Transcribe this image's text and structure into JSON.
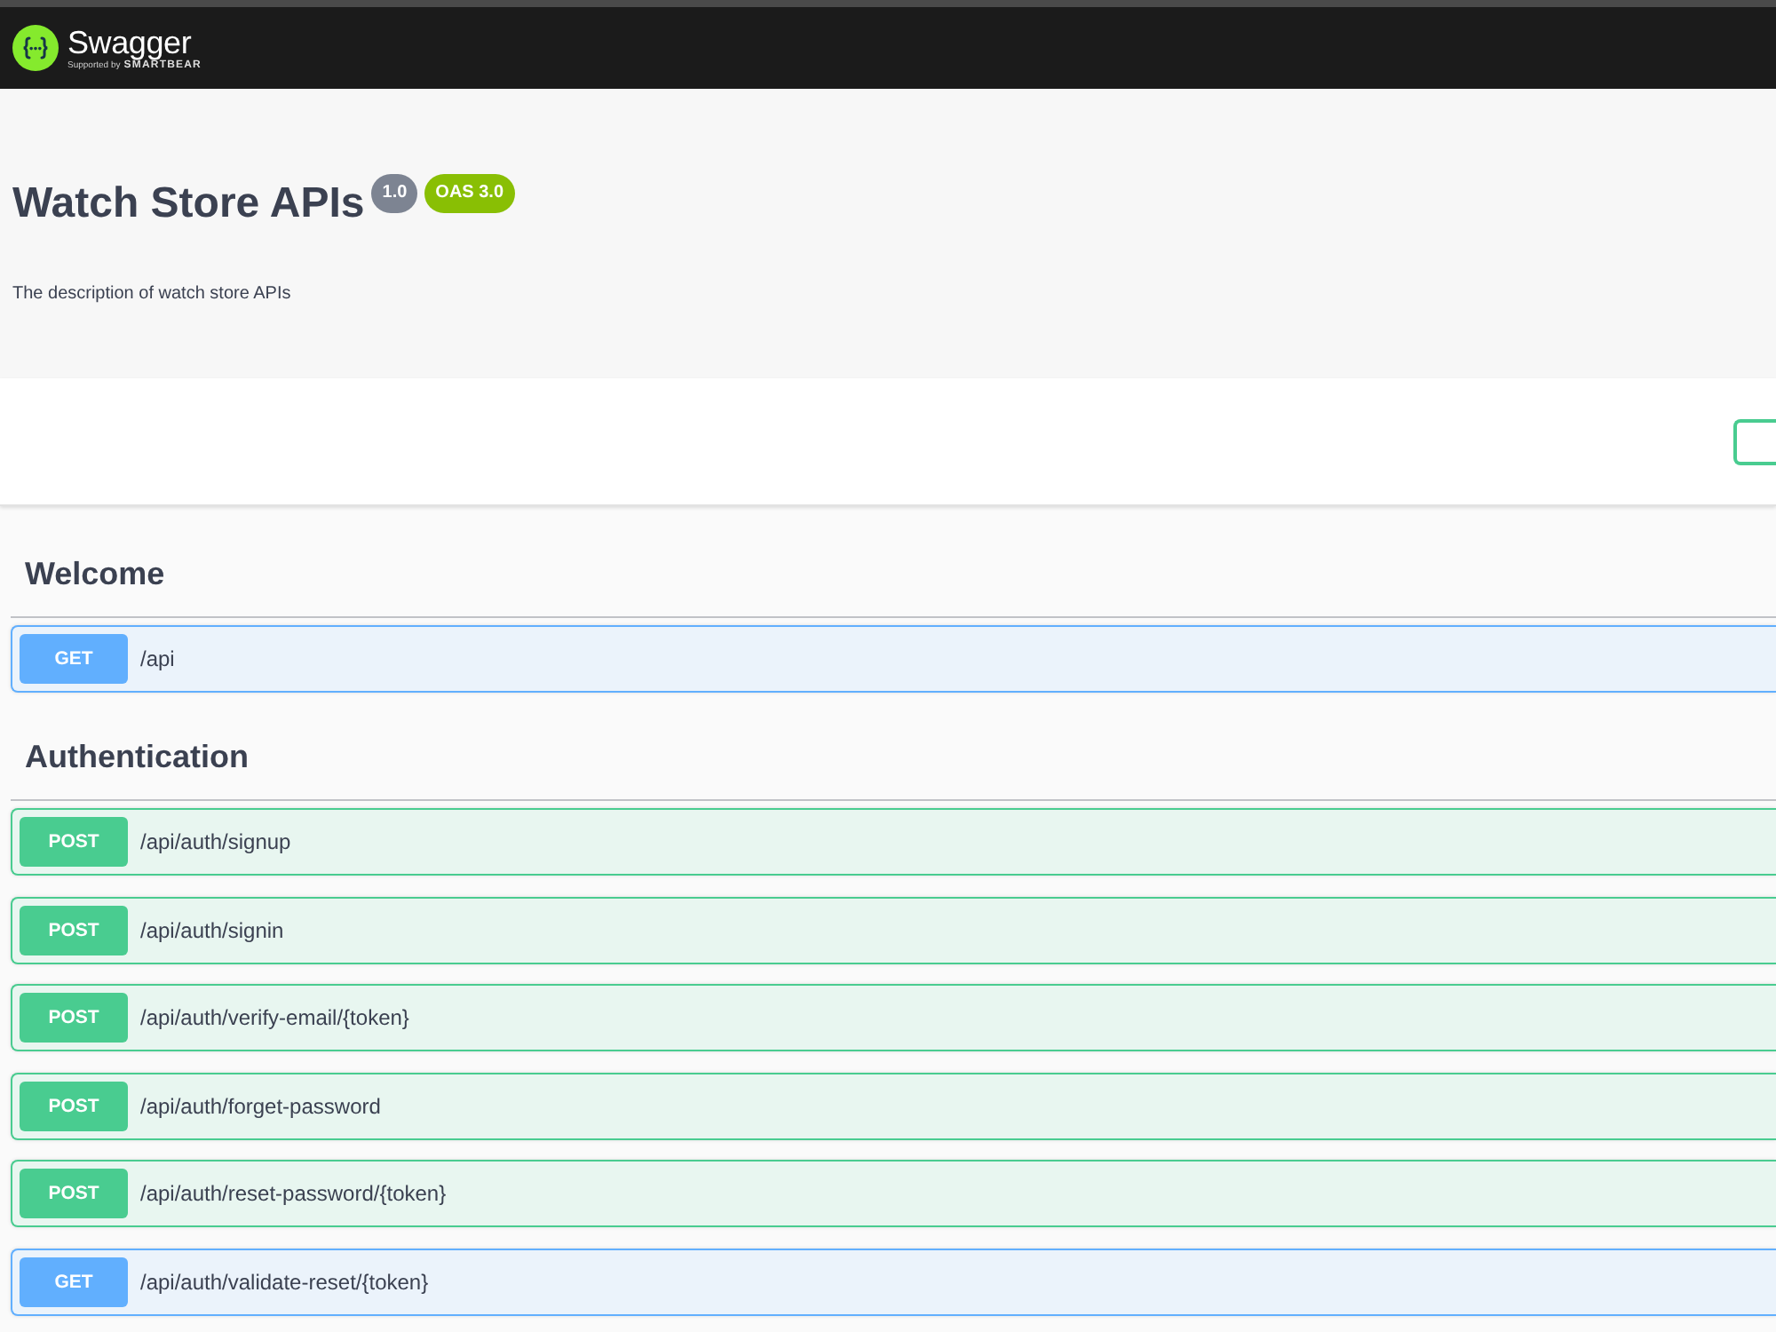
{
  "topbar": {
    "logo_text": "Swagger",
    "supported_by": "Supported by",
    "sponsor": "SMARTBEAR"
  },
  "info": {
    "title": "Watch Store APIs",
    "version": "1.0",
    "spec": "OAS 3.0",
    "description": "The description of watch store APIs"
  },
  "tags": [
    {
      "name": "Welcome",
      "operations": [
        {
          "method": "GET",
          "path": "/api"
        }
      ]
    },
    {
      "name": "Authentication",
      "operations": [
        {
          "method": "POST",
          "path": "/api/auth/signup"
        },
        {
          "method": "POST",
          "path": "/api/auth/signin"
        },
        {
          "method": "POST",
          "path": "/api/auth/verify-email/{token}"
        },
        {
          "method": "POST",
          "path": "/api/auth/forget-password"
        },
        {
          "method": "POST",
          "path": "/api/auth/reset-password/{token}"
        },
        {
          "method": "GET",
          "path": "/api/auth/validate-reset/{token}"
        }
      ]
    }
  ]
}
